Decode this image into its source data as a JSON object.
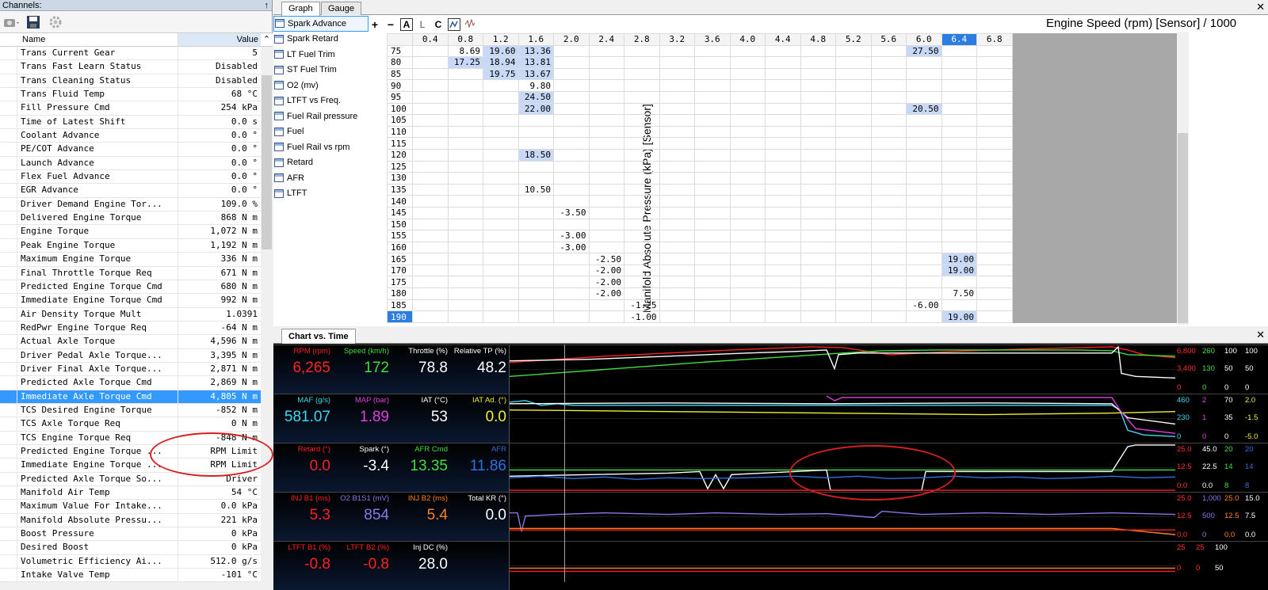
{
  "channels": {
    "title": "Channels:",
    "col_name": "Name",
    "col_value": "Value",
    "rows": [
      {
        "name": "Trans Current Gear",
        "value": "5"
      },
      {
        "name": "Trans Fast Learn Status",
        "value": "Disabled"
      },
      {
        "name": "Trans Cleaning Status",
        "value": "Disabled"
      },
      {
        "name": "Trans Fluid Temp",
        "value": "68 °C"
      },
      {
        "name": "Fill Pressure Cmd",
        "value": "254 kPa"
      },
      {
        "name": "Time of Latest Shift",
        "value": "0.0 s"
      },
      {
        "name": "Coolant Advance",
        "value": "0.0 °"
      },
      {
        "name": "PE/COT Advance",
        "value": "0.0 °"
      },
      {
        "name": "Launch Advance",
        "value": "0.0 °"
      },
      {
        "name": "Flex Fuel Advance",
        "value": "0.0 °"
      },
      {
        "name": "EGR Advance",
        "value": "0.0 °"
      },
      {
        "name": "Driver Demand Engine Tor...",
        "value": "109.0 %"
      },
      {
        "name": "Delivered Engine Torque",
        "value": "868 N m"
      },
      {
        "name": "Engine Torque",
        "value": "1,072 N m"
      },
      {
        "name": "Peak Engine Torque",
        "value": "1,192 N m"
      },
      {
        "name": "Maximum Engine Torque",
        "value": "336 N m"
      },
      {
        "name": "Final Throttle Torque Req",
        "value": "671 N m"
      },
      {
        "name": "Predicted Engine Torque Cmd",
        "value": "680 N m"
      },
      {
        "name": "Immediate Engine Torque Cmd",
        "value": "992 N m"
      },
      {
        "name": "Air Density Torque Mult",
        "value": "1.0391"
      },
      {
        "name": "RedPwr Engine Torque Req",
        "value": "-64 N m"
      },
      {
        "name": "Actual Axle Torque",
        "value": "4,596 N m"
      },
      {
        "name": "Driver Pedal Axle Torque...",
        "value": "3,395 N m"
      },
      {
        "name": "Driver Final Axle Torque...",
        "value": "2,871 N m"
      },
      {
        "name": "Predicted Axle Torque Cmd",
        "value": "2,869 N m"
      },
      {
        "name": "Immediate Axle Torque Cmd",
        "value": "4,805 N m",
        "selected": true
      },
      {
        "name": "TCS Desired Engine Torque",
        "value": "-852 N m"
      },
      {
        "name": "TCS Axle Torque Req",
        "value": "0 N m"
      },
      {
        "name": "TCS Engine Torque Req",
        "value": "-848 N m"
      },
      {
        "name": "Predicted Engine Torque ...",
        "value": "RPM Limit"
      },
      {
        "name": "Immediate Engine Torque ...",
        "value": "RPM Limit"
      },
      {
        "name": "Predicted Axle Torque So...",
        "value": "Driver"
      },
      {
        "name": "Manifold Air Temp",
        "value": "54 °C"
      },
      {
        "name": "Maximum Value For Intake...",
        "value": "0.0 kPa"
      },
      {
        "name": "Manifold Absolute Pressu...",
        "value": "221 kPa"
      },
      {
        "name": "Boost Pressure",
        "value": "0 kPa"
      },
      {
        "name": "Desired Boost",
        "value": "0 kPa"
      },
      {
        "name": "Volumetric Efficiency Ai...",
        "value": "512.0 g/s"
      },
      {
        "name": "Intake Valve Temp",
        "value": "-101 °C"
      }
    ]
  },
  "tabs": {
    "graph": "Graph",
    "gauge": "Gauge"
  },
  "graph_list": [
    "Spark Advance",
    "Spark Retard",
    "LT Fuel Trim",
    "ST Fuel Trim",
    "O2 (mv)",
    "LTFT vs Freq.",
    "Fuel Rail pressure",
    "Fuel",
    "Fuel Rail vs rpm",
    "Retard",
    "AFR",
    "LTFT"
  ],
  "toolbar": {
    "plus": "+",
    "minus": "−",
    "a": "A",
    "l": "L",
    "c": "C"
  },
  "table": {
    "x_title": "Engine Speed (rpm) [Sensor] / 1000",
    "y_title": "Manifold Absolute Pressure (kPa) [Sensor]",
    "cols": [
      "0.4",
      "0.8",
      "1.2",
      "1.6",
      "2.0",
      "2.4",
      "2.8",
      "3.2",
      "3.6",
      "4.0",
      "4.4",
      "4.8",
      "5.2",
      "5.6",
      "6.0",
      "6.4",
      "6.8"
    ],
    "rows": [
      {
        "label": "75",
        "cells": {
          "1": "8.69",
          "2": "19.60",
          "3": "13.36",
          "14": "27.50"
        }
      },
      {
        "label": "80",
        "cells": {
          "1": "17.25",
          "2": "18.94",
          "3": "13.81"
        }
      },
      {
        "label": "85",
        "cells": {
          "2": "19.75",
          "3": "13.67"
        }
      },
      {
        "label": "90",
        "cells": {
          "3": "9.80"
        }
      },
      {
        "label": "95",
        "cells": {
          "3": "24.50"
        }
      },
      {
        "label": "100",
        "cells": {
          "3": "22.00",
          "14": "20.50"
        }
      },
      {
        "label": "105",
        "cells": {}
      },
      {
        "label": "110",
        "cells": {}
      },
      {
        "label": "115",
        "cells": {}
      },
      {
        "label": "120",
        "cells": {
          "3": "18.50"
        }
      },
      {
        "label": "125",
        "cells": {}
      },
      {
        "label": "130",
        "cells": {}
      },
      {
        "label": "135",
        "cells": {
          "3": "10.50"
        }
      },
      {
        "label": "140",
        "cells": {}
      },
      {
        "label": "145",
        "cells": {
          "4": "-3.50"
        }
      },
      {
        "label": "150",
        "cells": {}
      },
      {
        "label": "155",
        "cells": {
          "4": "-3.00"
        }
      },
      {
        "label": "160",
        "cells": {
          "4": "-3.00"
        }
      },
      {
        "label": "165",
        "cells": {
          "5": "-2.50",
          "15": "19.00"
        }
      },
      {
        "label": "170",
        "cells": {
          "5": "-2.00",
          "15": "19.00"
        }
      },
      {
        "label": "175",
        "cells": {
          "5": "-2.00"
        }
      },
      {
        "label": "180",
        "cells": {
          "5": "-2.00",
          "15": "7.50"
        }
      },
      {
        "label": "185",
        "cells": {
          "6": "-1.25",
          "14": "-6.00"
        }
      },
      {
        "label": "190",
        "cells": {
          "6": "-1.00",
          "15": "19.00"
        }
      }
    ]
  },
  "chart_vs_time": {
    "tab": "Chart vs. Time",
    "strips": [
      {
        "gauges": [
          {
            "label": "RPM (rpm)",
            "value": "6,265",
            "color": "#ff2020"
          },
          {
            "label": "Speed (km/h)",
            "value": "172",
            "color": "#40e040"
          },
          {
            "label": "Throttle (%)",
            "value": "78.8",
            "color": "#ffffff"
          },
          {
            "label": "Relative TP (%)",
            "value": "48.2",
            "color": "#ffffff"
          }
        ],
        "axis": [
          [
            "6,800",
            "#ff3030"
          ],
          [
            "260",
            "#40e040"
          ],
          [
            "100",
            "#ffffff"
          ],
          [
            "100",
            "#ffffff"
          ],
          [
            "3,400",
            "#ff3030"
          ],
          [
            "130",
            "#40e040"
          ],
          [
            "50",
            "#ffffff"
          ],
          [
            "50",
            "#ffffff"
          ],
          [
            "0",
            "#ff3030"
          ],
          [
            "0",
            "#40e040"
          ],
          [
            "0",
            "#ffffff"
          ],
          [
            "0",
            "#ffffff"
          ]
        ]
      },
      {
        "gauges": [
          {
            "label": "MAF (g/s)",
            "value": "581.07",
            "color": "#40d8f0"
          },
          {
            "label": "MAP (bar)",
            "value": "1.89",
            "color": "#e040e0"
          },
          {
            "label": "IAT (°C)",
            "value": "53",
            "color": "#ffffff"
          },
          {
            "label": "IAT Ad. (°)",
            "value": "0.0",
            "color": "#f0f030"
          }
        ],
        "axis": [
          [
            "460",
            "#40d8f0"
          ],
          [
            "2",
            "#e040e0"
          ],
          [
            "70",
            "#ffffff"
          ],
          [
            "2.0",
            "#f0f030"
          ],
          [
            "230",
            "#40d8f0"
          ],
          [
            "1",
            "#e040e0"
          ],
          [
            "35",
            "#ffffff"
          ],
          [
            "-1.5",
            "#f0f030"
          ],
          [
            "0",
            "#40d8f0"
          ],
          [
            "0",
            "#e040e0"
          ],
          [
            "0",
            "#ffffff"
          ],
          [
            "-5.0",
            "#f0f030"
          ]
        ]
      },
      {
        "gauges": [
          {
            "label": "Retard (°)",
            "value": "0.0",
            "color": "#ff2020"
          },
          {
            "label": "Spark (°)",
            "value": "-3.4",
            "color": "#ffffff"
          },
          {
            "label": "AFR Cmd",
            "value": "13.35",
            "color": "#40e040"
          },
          {
            "label": "AFR",
            "value": "11.86",
            "color": "#3070e0"
          }
        ],
        "axis": [
          [
            "25.0",
            "#ff3030"
          ],
          [
            "45.0",
            "#ffffff"
          ],
          [
            "20",
            "#40e040"
          ],
          [
            "20",
            "#3070e0"
          ],
          [
            "12.5",
            "#ff3030"
          ],
          [
            "22.5",
            "#ffffff"
          ],
          [
            "14",
            "#40e040"
          ],
          [
            "14",
            "#3070e0"
          ],
          [
            "0.0",
            "#ff3030"
          ],
          [
            "0.0",
            "#ffffff"
          ],
          [
            "8",
            "#40e040"
          ],
          [
            "8",
            "#3070e0"
          ]
        ]
      },
      {
        "gauges": [
          {
            "label": "INJ B1 (ms)",
            "value": "5.3",
            "color": "#ff2020"
          },
          {
            "label": "O2 B1S1 (mV)",
            "value": "854",
            "color": "#8878e8"
          },
          {
            "label": "INJ B2 (ms)",
            "value": "5.4",
            "color": "#ff8020"
          },
          {
            "label": "Total KR (°)",
            "value": "0.0",
            "color": "#ffffff"
          }
        ],
        "axis": [
          [
            "25.0",
            "#ff3030"
          ],
          [
            "1,000",
            "#8878e8"
          ],
          [
            "25.0",
            "#ff8020"
          ],
          [
            "15.0",
            "#ffffff"
          ],
          [
            "12.5",
            "#ff3030"
          ],
          [
            "500",
            "#8878e8"
          ],
          [
            "12.5",
            "#ff8020"
          ],
          [
            "7.5",
            "#ffffff"
          ],
          [
            "0.0",
            "#ff3030"
          ],
          [
            "0",
            "#8878e8"
          ],
          [
            "0.0",
            "#ff8020"
          ],
          [
            "0.0",
            "#ffffff"
          ]
        ]
      },
      {
        "gauges": [
          {
            "label": "LTFT B1 (%)",
            "value": "-0.8",
            "color": "#ff2020"
          },
          {
            "label": "LTFT B2 (%)",
            "value": "-0.8",
            "color": "#ff2020"
          },
          {
            "label": "Inj DC (%)",
            "value": "28.0",
            "color": "#ffffff"
          }
        ],
        "axis": [
          [
            "25",
            "#ff3030"
          ],
          [
            "25",
            "#ff3030"
          ],
          [
            "100",
            "#ffffff"
          ],
          [
            "0",
            "#ff3030"
          ],
          [
            "0",
            "#ff3030"
          ],
          [
            "50",
            "#ffffff"
          ]
        ]
      }
    ]
  },
  "colors": {
    "selected_row": "#3399ff",
    "highlight_cell": "#c7d9f6",
    "selected_cell": "#2b7ee0",
    "annotation": "#d62020"
  }
}
